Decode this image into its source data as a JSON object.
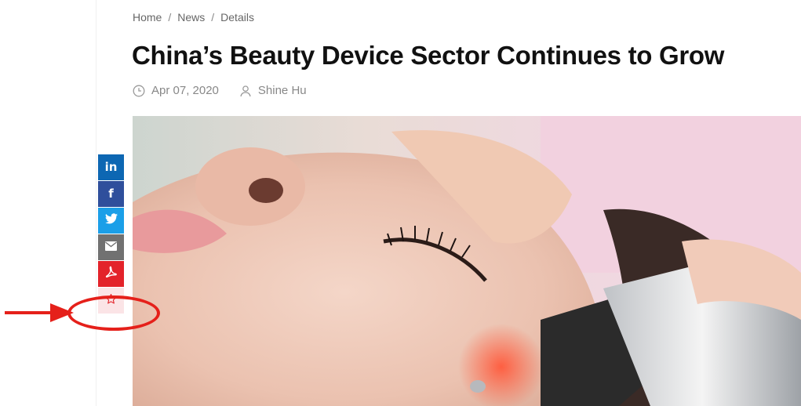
{
  "breadcrumb": {
    "home": "Home",
    "news": "News",
    "current": "Details",
    "separator": "/"
  },
  "article": {
    "title": "China’s Beauty Device Sector Continues to Grow",
    "date": "Apr 07, 2020",
    "author": "Shine Hu"
  },
  "share_bar": {
    "buttons": [
      {
        "network": "linkedin",
        "icon": "linkedin-icon",
        "glyph": "in",
        "color": "#0d67b3"
      },
      {
        "network": "facebook",
        "icon": "facebook-icon",
        "glyph": "f",
        "color": "#2f4f9c"
      },
      {
        "network": "twitter",
        "icon": "twitter-icon",
        "color": "#1b9fe8"
      },
      {
        "network": "email",
        "icon": "envelope-icon",
        "color": "#717171"
      },
      {
        "network": "pdf",
        "icon": "pdf-icon",
        "color": "#e3232a"
      },
      {
        "network": "favorite",
        "icon": "star-outline-icon",
        "color": "#fbe4e6"
      }
    ]
  },
  "annotation": {
    "color": "#e5201a",
    "target": "favorite"
  }
}
